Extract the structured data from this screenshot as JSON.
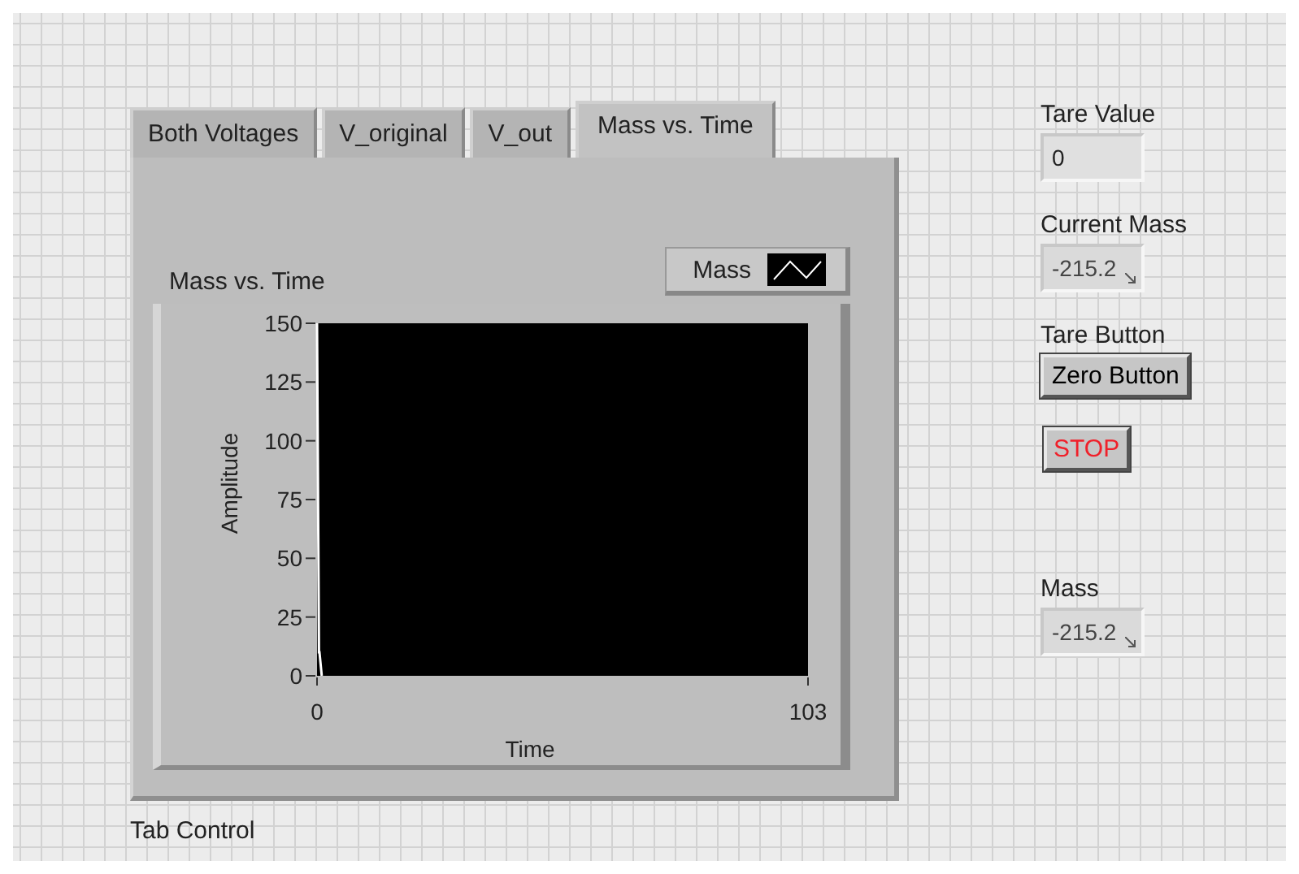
{
  "tab_control": {
    "label": "Tab Control",
    "tabs": [
      {
        "label": "Both Voltages",
        "selected": false
      },
      {
        "label": "V_original",
        "selected": false
      },
      {
        "label": "V_out",
        "selected": false
      },
      {
        "label": "Mass vs. Time",
        "selected": true
      }
    ],
    "graph": {
      "title": "Mass vs. Time",
      "chart_data": {
        "type": "line",
        "xlabel": "Time",
        "ylabel": "Amplitude",
        "x": [
          0,
          0.4,
          0.5,
          1
        ],
        "series": [
          {
            "name": "Mass",
            "color": "#ffffff",
            "values": [
              150,
              10,
              10,
              0
            ]
          }
        ],
        "xlim": [
          0,
          103
        ],
        "ylim": [
          0,
          150
        ],
        "xticks": [
          0,
          103
        ],
        "yticks": [
          0,
          25,
          50,
          75,
          100,
          125,
          150
        ]
      }
    }
  },
  "controls": [
    {
      "kind": "numeric_control",
      "label": "Tare Value",
      "value": "0"
    },
    {
      "kind": "numeric_indicator",
      "label": "Current Mass",
      "value": "-215.2"
    },
    {
      "kind": "button",
      "label": "Tare Button",
      "text": "Zero Button"
    },
    {
      "kind": "stop_button",
      "text": "STOP"
    }
  ],
  "indicators": [
    {
      "kind": "numeric_indicator",
      "label": "Mass",
      "value": "-215.2"
    }
  ]
}
